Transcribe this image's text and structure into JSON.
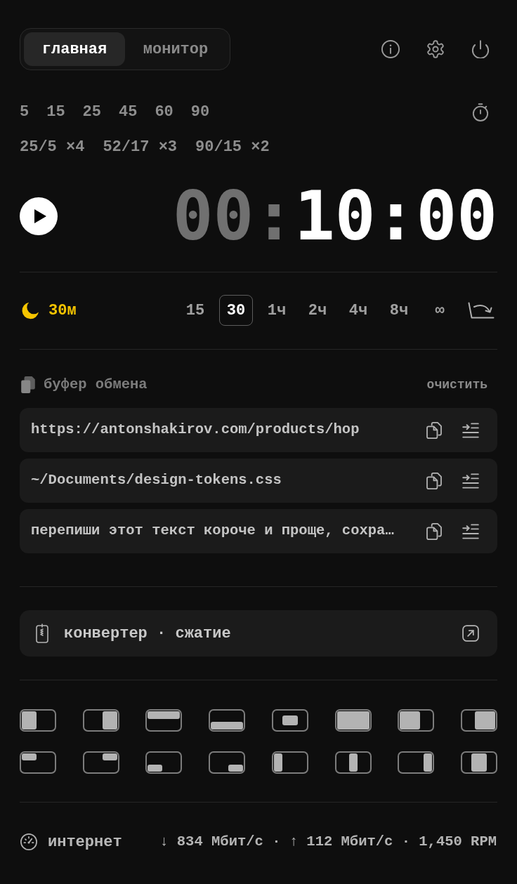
{
  "tabs": [
    {
      "label": "главная",
      "selected": true
    },
    {
      "label": "монитор",
      "selected": false
    }
  ],
  "timer": {
    "presets": [
      "5",
      "15",
      "25",
      "45",
      "60",
      "90"
    ],
    "cycles": [
      "25/5 ×4",
      "52/17 ×3",
      "90/15 ×2"
    ],
    "playing": false,
    "display": [
      {
        "text": "00:",
        "lit": false
      },
      {
        "text": "10:00",
        "lit": true
      }
    ]
  },
  "sleep": {
    "label": "30м",
    "options": [
      {
        "label": "15",
        "selected": false
      },
      {
        "label": "30",
        "selected": true
      },
      {
        "label": "1ч",
        "selected": false
      },
      {
        "label": "2ч",
        "selected": false
      },
      {
        "label": "4ч",
        "selected": false
      },
      {
        "label": "8ч",
        "selected": false
      },
      {
        "label": "∞",
        "selected": false
      }
    ]
  },
  "clipboard": {
    "title": "буфер обмена",
    "clear": "очистить",
    "items": [
      "https://antonshakirov.com/products/hop",
      "~/Documents/design-tokens.css",
      "перепиши этот текст короче и проще, сохра…"
    ]
  },
  "converter": {
    "label": "конвертер · сжатие"
  },
  "window_layouts": [
    {
      "kind": "left-half"
    },
    {
      "kind": "right-half"
    },
    {
      "kind": "top-half"
    },
    {
      "kind": "bottom-half"
    },
    {
      "kind": "center"
    },
    {
      "kind": "maximize"
    },
    {
      "kind": "left-two-thirds"
    },
    {
      "kind": "right-two-thirds"
    },
    {
      "kind": "top-left"
    },
    {
      "kind": "top-right"
    },
    {
      "kind": "bottom-left"
    },
    {
      "kind": "bottom-right"
    },
    {
      "kind": "left-third"
    },
    {
      "kind": "center-third"
    },
    {
      "kind": "right-third"
    },
    {
      "kind": "center-half"
    }
  ],
  "network": {
    "label": "интернет",
    "stats": "↓ 834 Мбит/с · ↑ 112 Мбит/с · 1,450 RPM"
  }
}
